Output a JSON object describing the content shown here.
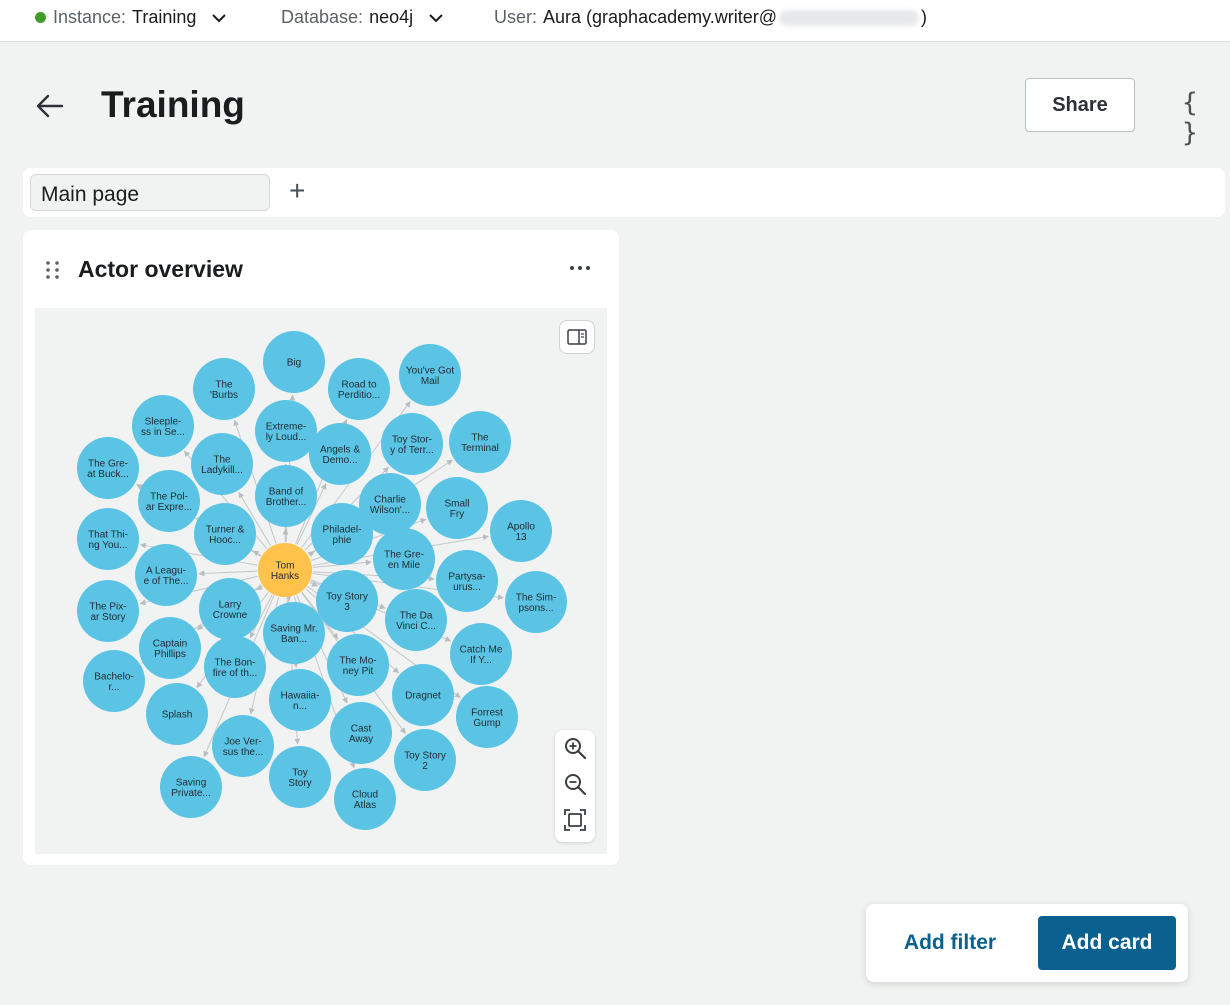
{
  "topbar": {
    "instance_label": "Instance:",
    "instance_value": "Training",
    "instance_status_color": "#3f9b2a",
    "database_label": "Database:",
    "database_value": "neo4j",
    "user_label": "User:",
    "user_value_prefix": "Aura (graphacademy.writer@",
    "user_value_suffix": ")"
  },
  "header": {
    "title": "Training",
    "share_label": "Share",
    "json_label": "{ }"
  },
  "tabs": {
    "items": [
      {
        "label": "Main page"
      }
    ],
    "add_label": "+"
  },
  "card": {
    "title": "Actor overview",
    "graph": {
      "center": {
        "label": "Tom Hanks",
        "color": "#ffc24a"
      },
      "node_color": "#5bc4e5",
      "movies": [
        "Big",
        "The 'Burbs",
        "Road to Perditio...",
        "You've Got Mail",
        "Sleeple-ss in Se...",
        "Extreme-ly Loud...",
        "Toy Stor-y of Terr...",
        "The Terminal",
        "The Gre-at Buck...",
        "The Ladykill...",
        "Angels & Demo...",
        "Band of Brother...",
        "Charlie Wilson'...",
        "Small Fry",
        "The Pol-ar Expre...",
        "Apollo 13",
        "That Thi-ng You...",
        "Turner & Hooc...",
        "Philadel-phie",
        "The Gre-en Mile",
        "A Leagu-e of The...",
        "Partysa-urus...",
        "The Sim-psons...",
        "The Pix-ar Story",
        "Larry Crowne",
        "Toy Story 3",
        "The Da Vinci C...",
        "Captain Phillips",
        "Saving Mr. Ban...",
        "Catch Me If Y...",
        "The Bon-fire of th...",
        "The Mo-ney Pit",
        "Bachelo-r...",
        "Dragnet",
        "Hawaiia-n...",
        "Forrest Gump",
        "Splash",
        "Cast Away",
        "Joe Ver-sus the...",
        "Toy Story 2",
        "Toy Story",
        "Saving Private...",
        "Cloud Atlas"
      ]
    }
  },
  "actions": {
    "add_filter_label": "Add filter",
    "add_card_label": "Add card"
  }
}
